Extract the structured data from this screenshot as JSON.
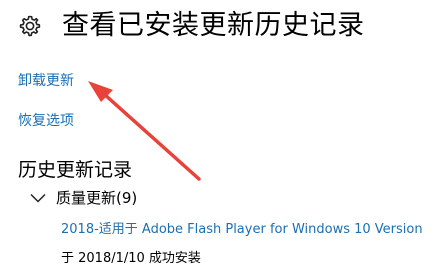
{
  "header": {
    "title": "查看已安装更新历史记录",
    "icon": "gear-icon"
  },
  "links": {
    "uninstall_updates": "卸载更新",
    "recovery_options": "恢复选项"
  },
  "history": {
    "title": "历史更新记录",
    "groups": [
      {
        "label": "质量更新(9)",
        "expanded": true,
        "items": [
          {
            "name": "2018-适用于 Adobe Flash Player for Windows 10 Version",
            "status": "于 2018/1/10 成功安装"
          }
        ]
      }
    ]
  },
  "colors": {
    "link": "#1b6fb3",
    "annotation_arrow": "#e8423a"
  }
}
